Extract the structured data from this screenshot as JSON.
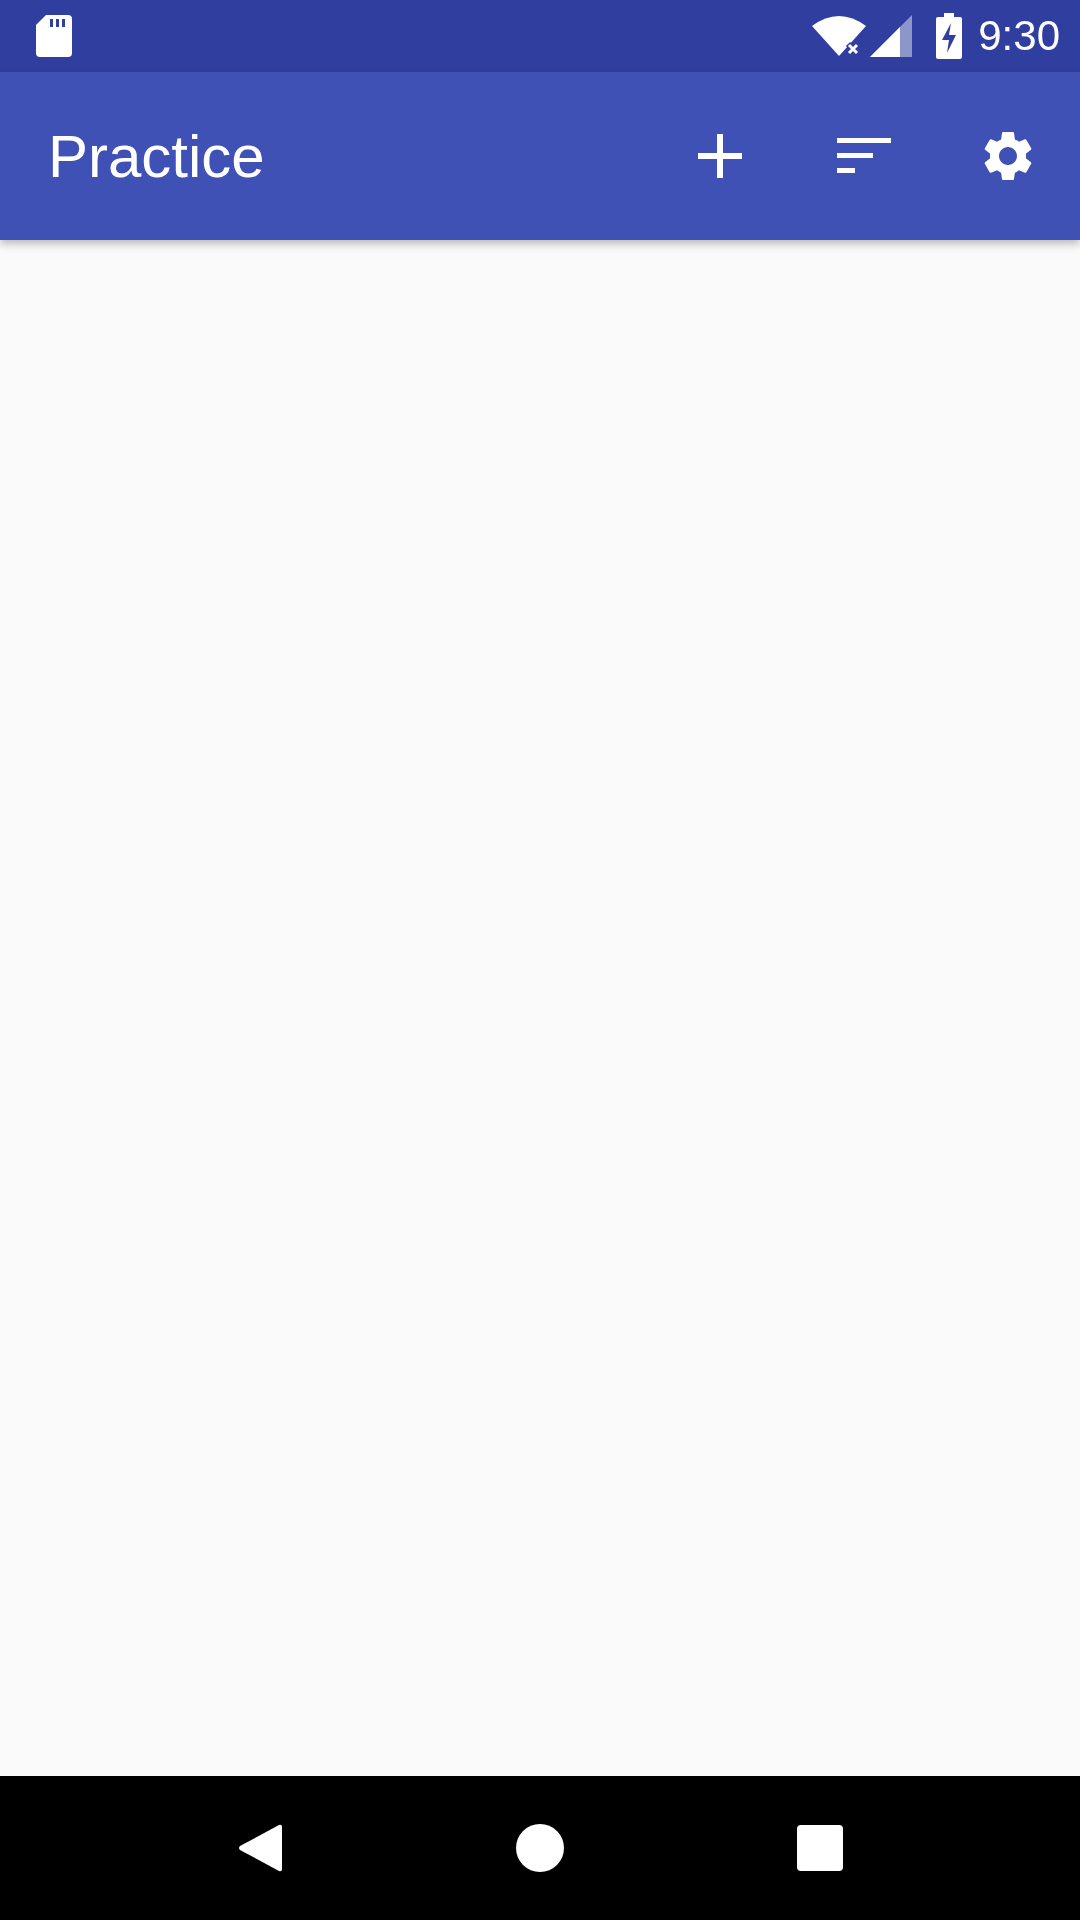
{
  "status_bar": {
    "time": "9:30"
  },
  "app_bar": {
    "title": "Practice"
  }
}
